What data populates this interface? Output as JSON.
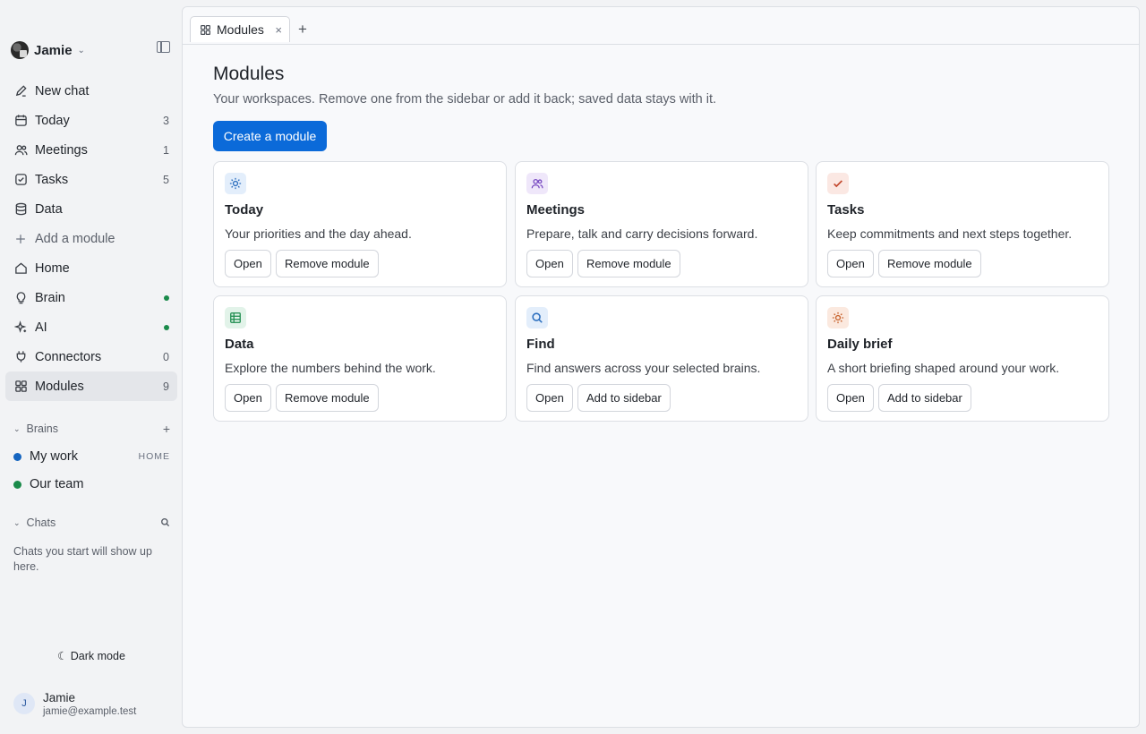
{
  "account": {
    "name": "Jamie"
  },
  "nav": [
    {
      "label": "New chat",
      "count": "",
      "icon": "pencil-icon"
    },
    {
      "label": "Today",
      "count": "3",
      "icon": "calendar-icon"
    },
    {
      "label": "Meetings",
      "count": "1",
      "icon": "people-icon"
    },
    {
      "label": "Tasks",
      "count": "5",
      "icon": "check-square-icon"
    },
    {
      "label": "Data",
      "count": "",
      "icon": "database-icon"
    },
    {
      "label": "Add a module",
      "count": "",
      "icon": "plus-icon"
    },
    {
      "label": "Home",
      "count": "",
      "icon": "home-icon"
    },
    {
      "label": "Brain",
      "count": "",
      "icon": "lightbulb-icon",
      "status": "green-dot"
    },
    {
      "label": "AI",
      "count": "",
      "icon": "sparkle-icon",
      "status": "green-dot"
    },
    {
      "label": "Connectors",
      "count": "0",
      "icon": "plug-icon"
    },
    {
      "label": "Modules",
      "count": "9",
      "icon": "grid-icon",
      "active": true
    }
  ],
  "brains": {
    "title": "Brains",
    "items": [
      {
        "label": "My work",
        "tag": "HOME",
        "color": "#1565c0"
      },
      {
        "label": "Our team",
        "tag": "",
        "color": "#1a8a4a"
      }
    ]
  },
  "chats": {
    "title": "Chats",
    "empty_text": "Chats you start will show up here."
  },
  "dark_mode_label": "Dark mode",
  "user": {
    "initial": "J",
    "name": "Jamie",
    "email": "jamie@example.test"
  },
  "tabs": [
    {
      "label": "Modules",
      "close": "×"
    }
  ],
  "tab_add": "+",
  "page": {
    "title": "Modules",
    "subtitle": "Your workspaces. Remove one from the sidebar or add it back; saved data stays with it.",
    "create_button": "Create a module"
  },
  "modules": [
    {
      "title": "Today",
      "desc": "Your priorities and the day ahead.",
      "open": "Open",
      "action": "Remove module",
      "icon": "sun-icon",
      "icon_color": "#2c6fbf",
      "icon_bg": "#e3eefb"
    },
    {
      "title": "Meetings",
      "desc": "Prepare, talk and carry decisions forward.",
      "open": "Open",
      "action": "Remove module",
      "icon": "people-icon",
      "icon_color": "#7a4cc2",
      "icon_bg": "#efe7fa"
    },
    {
      "title": "Tasks",
      "desc": "Keep commitments and next steps together.",
      "open": "Open",
      "action": "Remove module",
      "icon": "check-icon",
      "icon_color": "#c2462c",
      "icon_bg": "#fbe8e3"
    },
    {
      "title": "Data",
      "desc": "Explore the numbers behind the work.",
      "open": "Open",
      "action": "Remove module",
      "icon": "table-icon",
      "icon_color": "#1a8a4a",
      "icon_bg": "#e2f3e9"
    },
    {
      "title": "Find",
      "desc": "Find answers across your selected brains.",
      "open": "Open",
      "action": "Add to sidebar",
      "icon": "search-icon",
      "icon_color": "#2c6fbf",
      "icon_bg": "#e3eefb"
    },
    {
      "title": "Daily brief",
      "desc": "A short briefing shaped around your work.",
      "open": "Open",
      "action": "Add to sidebar",
      "icon": "sun-icon",
      "icon_color": "#c7622c",
      "icon_bg": "#fbe9df"
    }
  ]
}
